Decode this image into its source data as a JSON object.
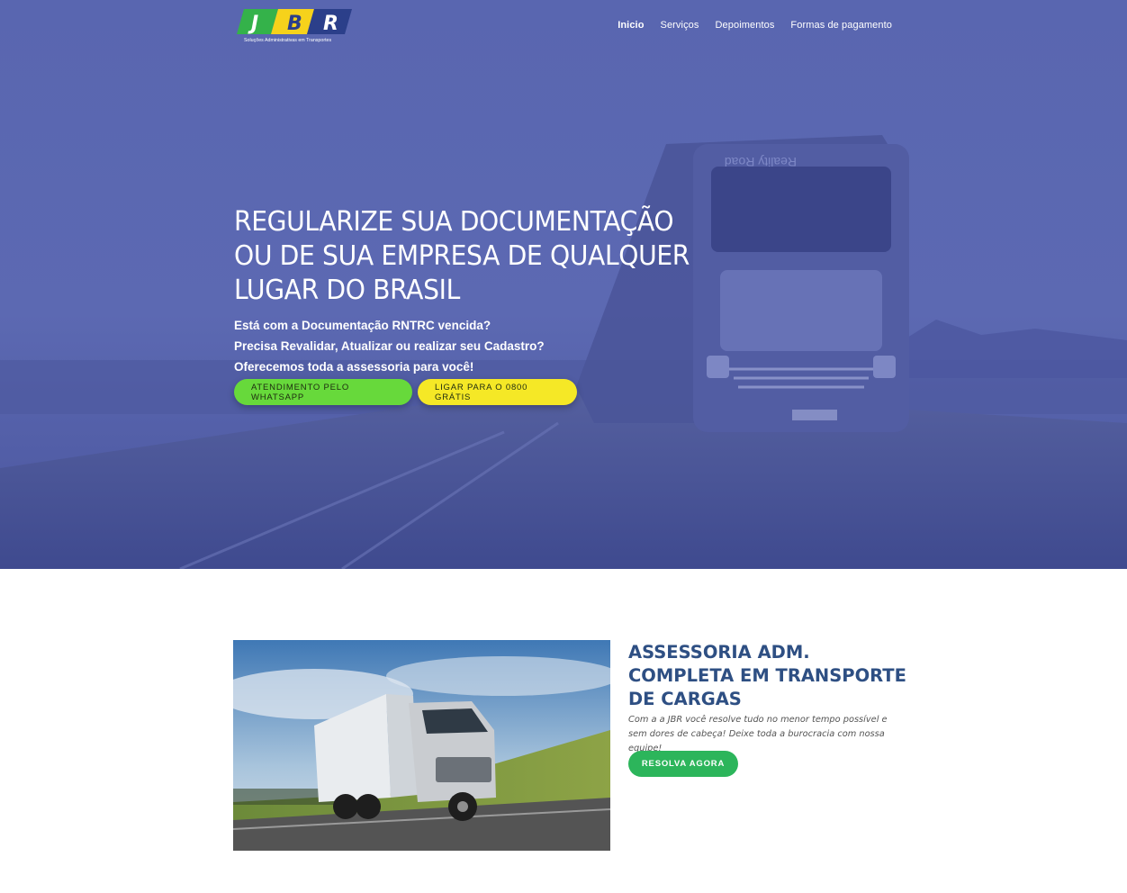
{
  "brand": {
    "logo_letters": [
      "J",
      "B",
      "R"
    ],
    "logo_tagline": "Soluções Administrativas em Transportes"
  },
  "nav": {
    "items": [
      {
        "label": "Inicio",
        "active": true
      },
      {
        "label": "Serviços",
        "active": false
      },
      {
        "label": "Depoimentos",
        "active": false
      },
      {
        "label": "Formas de pagamento",
        "active": false
      }
    ]
  },
  "hero": {
    "title_lines": [
      "REGULARIZE SUA DOCUMENTAÇÃO",
      "OU DE SUA EMPRESA DE QUALQUER",
      "LUGAR DO BRASIL"
    ],
    "lines": [
      "Está com a Documentação RNTRC vencida?",
      "Precisa Revalidar, Atualizar ou realizar seu Cadastro?",
      "Oferecemos toda a assessoria para você!"
    ],
    "buttons": {
      "whatsapp": "ATENDIMENTO PELO WHATSAPP",
      "call": "LIGAR PARA O 0800 GRÁTIS"
    },
    "truck_sign": "Reality Road"
  },
  "section2": {
    "title_lines": [
      "ASSESSORIA ADM.",
      "COMPLETA EM TRANSPORTE",
      "DE CARGAS"
    ],
    "text": "Com a a JBR você resolve tudo no menor tempo possível e sem dores de cabeça! Deixe toda a burocracia com nossa equipe!",
    "button": "RESOLVA AGORA"
  },
  "colors": {
    "hero_overlay": "#5663ad",
    "whatsapp_button": "#67d93b",
    "call_button": "#f5e826",
    "section_title": "#2e4f83",
    "cta_button": "#2cb55b"
  }
}
